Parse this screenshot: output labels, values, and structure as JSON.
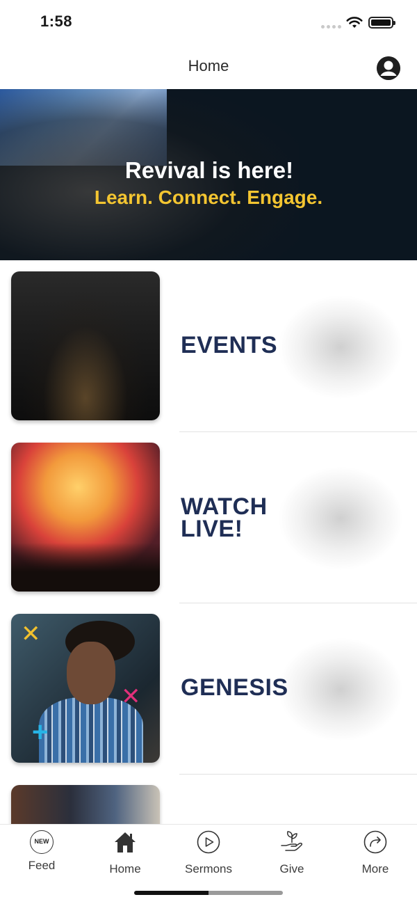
{
  "status_bar": {
    "time": "1:58"
  },
  "nav": {
    "title": "Home"
  },
  "hero": {
    "title": "Revival is here!",
    "subtitle": "Learn. Connect. Engage."
  },
  "tiles": [
    {
      "label": "EVENTS"
    },
    {
      "label_line1": "WATCH",
      "label_line2": "LIVE!"
    },
    {
      "label": "GENESIS"
    }
  ],
  "tab_bar": {
    "feed": {
      "badge": "NEW",
      "label": "Feed"
    },
    "home": {
      "label": "Home"
    },
    "sermons": {
      "label": "Sermons"
    },
    "give": {
      "label": "Give"
    },
    "more": {
      "label": "More"
    }
  },
  "colors": {
    "tile_label": "#1f2e55",
    "hero_subtitle": "#f3c531",
    "hero_bg": "#0b1620"
  },
  "icons": [
    "wifi-icon",
    "battery-icon",
    "profile-icon",
    "new-badge-icon",
    "home-icon",
    "play-icon",
    "give-plant-icon",
    "share-arrow-icon"
  ]
}
